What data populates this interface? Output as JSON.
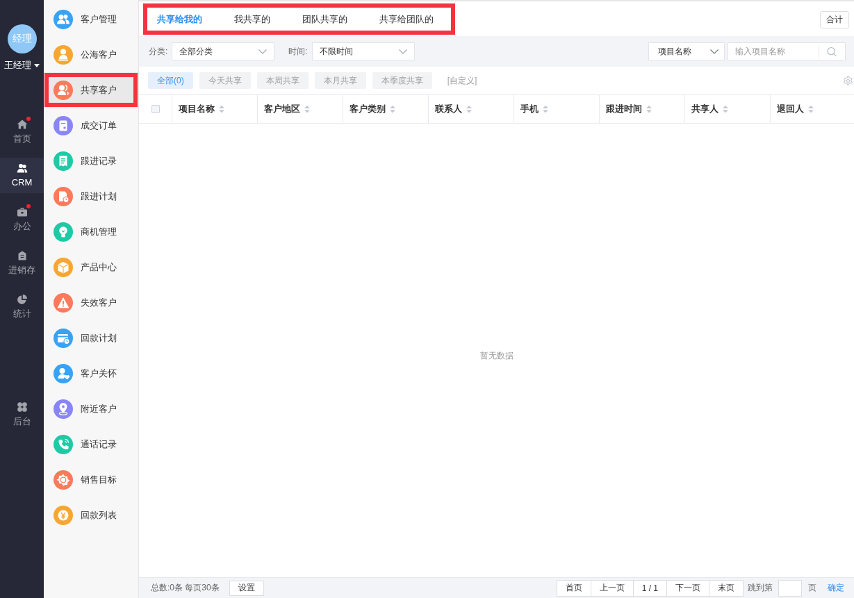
{
  "nav": {
    "avatar_text": "经理",
    "user_name": "王经理",
    "items": [
      {
        "label": "首页",
        "kind": "home",
        "badge": true,
        "selected": false
      },
      {
        "label": "CRM",
        "kind": "crm",
        "badge": false,
        "selected": true
      },
      {
        "label": "办公",
        "kind": "office",
        "badge": true,
        "selected": false
      },
      {
        "label": "进销存",
        "kind": "inventory",
        "badge": false,
        "selected": false
      },
      {
        "label": "统计",
        "kind": "stats",
        "badge": false,
        "selected": false
      }
    ],
    "bottom_items": [
      {
        "label": "后台",
        "kind": "admin",
        "badge": false,
        "selected": false
      }
    ]
  },
  "sidebar": {
    "items": [
      {
        "label": "客户管理",
        "kind": "users",
        "color": "#36a3f7",
        "selected": false,
        "highlighted": false
      },
      {
        "label": "公海客户",
        "kind": "user",
        "color": "#f8a632",
        "selected": false,
        "highlighted": false
      },
      {
        "label": "共享客户",
        "kind": "shared",
        "color": "#fb7a5c",
        "selected": true,
        "highlighted": true
      },
      {
        "label": "成交订单",
        "kind": "order",
        "color": "#8a85f7",
        "selected": false,
        "highlighted": false
      },
      {
        "label": "跟进记录",
        "kind": "record",
        "color": "#1ecaa6",
        "selected": false,
        "highlighted": false
      },
      {
        "label": "跟进计划",
        "kind": "plan",
        "color": "#fb7a5c",
        "selected": false,
        "highlighted": false
      },
      {
        "label": "商机管理",
        "kind": "bulb",
        "color": "#1ecaa6",
        "selected": false,
        "highlighted": false
      },
      {
        "label": "产品中心",
        "kind": "box",
        "color": "#f8a632",
        "selected": false,
        "highlighted": false
      },
      {
        "label": "失效客户",
        "kind": "warning",
        "color": "#fb7a5c",
        "selected": false,
        "highlighted": false
      },
      {
        "label": "回款计划",
        "kind": "payment",
        "color": "#36a3f7",
        "selected": false,
        "highlighted": false
      },
      {
        "label": "客户关怀",
        "kind": "care",
        "color": "#36a3f7",
        "selected": false,
        "highlighted": false
      },
      {
        "label": "附近客户",
        "kind": "pin",
        "color": "#8a85f7",
        "selected": false,
        "highlighted": false
      },
      {
        "label": "通话记录",
        "kind": "phone",
        "color": "#1ecaa6",
        "selected": false,
        "highlighted": false
      },
      {
        "label": "销售目标",
        "kind": "target",
        "color": "#fb7a5c",
        "selected": false,
        "highlighted": false
      },
      {
        "label": "回款列表",
        "kind": "coin",
        "color": "#f8a632",
        "selected": false,
        "highlighted": false
      }
    ]
  },
  "tabs": {
    "highlighted": true,
    "items": [
      {
        "label": "共享给我的",
        "selected": true
      },
      {
        "label": "我共享的",
        "selected": false
      },
      {
        "label": "团队共享的",
        "selected": false
      },
      {
        "label": "共享给团队的",
        "selected": false
      }
    ]
  },
  "total_button": "合计",
  "filters": {
    "category": {
      "label": "分类:",
      "value": "全部分类"
    },
    "time": {
      "label": "时间:",
      "value": "不限时间"
    },
    "search_scope": {
      "value": "项目名称"
    },
    "search": {
      "placeholder": "输入项目名称"
    }
  },
  "quick_filters": [
    {
      "label": "全部(0)",
      "kind": "chip",
      "selected": true
    },
    {
      "label": "今天共享",
      "kind": "chip",
      "selected": false
    },
    {
      "label": "本周共享",
      "kind": "chip",
      "selected": false
    },
    {
      "label": "本月共享",
      "kind": "chip",
      "selected": false
    },
    {
      "label": "本季度共享",
      "kind": "chip",
      "selected": false
    },
    {
      "label": "[自定义]",
      "kind": "link",
      "selected": false
    }
  ],
  "table": {
    "select_all": false,
    "columns": [
      "项目名称",
      "客户地区",
      "客户类别",
      "联系人",
      "手机",
      "跟进时间",
      "共享人",
      "退回人"
    ],
    "empty_text": "暂无数据"
  },
  "footer": {
    "summary": "总数:0条 每页30条",
    "settings_button": "设置",
    "pager_before": [
      "首页",
      "上一页"
    ],
    "page_indicator": "1 / 1",
    "pager_after": [
      "下一页",
      "末页"
    ],
    "jump_label": "跳到第",
    "page_unit": "页",
    "confirm": "确定"
  }
}
